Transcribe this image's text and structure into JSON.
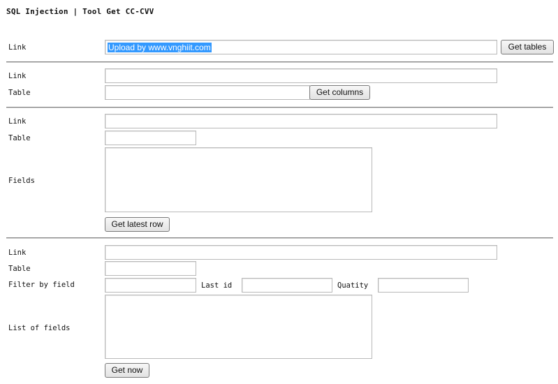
{
  "title": "SQL Injection | Tool Get CC-CVV",
  "section1": {
    "link_label": "Link",
    "link_value": "Upload by www.vnghiit.com",
    "button": "Get tables"
  },
  "section2": {
    "link_label": "Link",
    "table_label": "Table",
    "button": "Get columns"
  },
  "section3": {
    "link_label": "Link",
    "table_label": "Table",
    "fields_label": "Fields",
    "button": "Get latest row"
  },
  "section4": {
    "link_label": "Link",
    "table_label": "Table",
    "filter_label": "Filter by field",
    "lastid_label": "Last id",
    "quantity_label": "Quatity",
    "list_label": "List of fields",
    "button": "Get now"
  }
}
